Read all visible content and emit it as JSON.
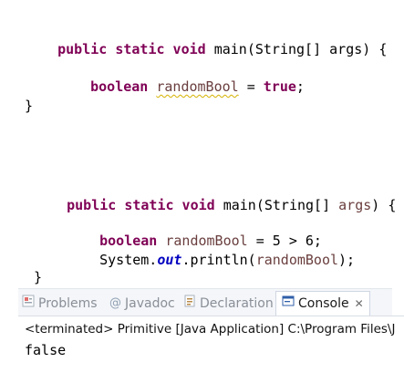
{
  "snippet1": {
    "line1": {
      "kw": "public static void",
      "rest": " main(String[] args) {"
    },
    "line2": {
      "kw": "boolean",
      "var": "randomBool",
      "op": " = ",
      "val": "true",
      "end": ";"
    },
    "line3": "}"
  },
  "snippet2": {
    "line1": {
      "kw": "public static void",
      "rest": " main(String[] ",
      "var": "args",
      "end": ") {"
    },
    "line2": {
      "kw": "boolean",
      "var": "randomBool",
      "rest": " = 5 > 6;"
    },
    "line3": {
      "pre": "System.",
      "field": "out",
      "mid": ".println(",
      "var": "randomBool",
      "end": ");"
    },
    "line4": "}"
  },
  "console": {
    "tabs": [
      {
        "label": "Problems",
        "icon": "problems-icon"
      },
      {
        "label": "Javadoc",
        "icon": "at-icon"
      },
      {
        "label": "Declaration",
        "icon": "declaration-icon"
      },
      {
        "label": "Console",
        "icon": "console-icon",
        "active": true
      }
    ],
    "close_symbol": "✕",
    "terminated_text": "<terminated> Primitive [Java Application] C:\\Program Files\\J",
    "output": "false"
  }
}
